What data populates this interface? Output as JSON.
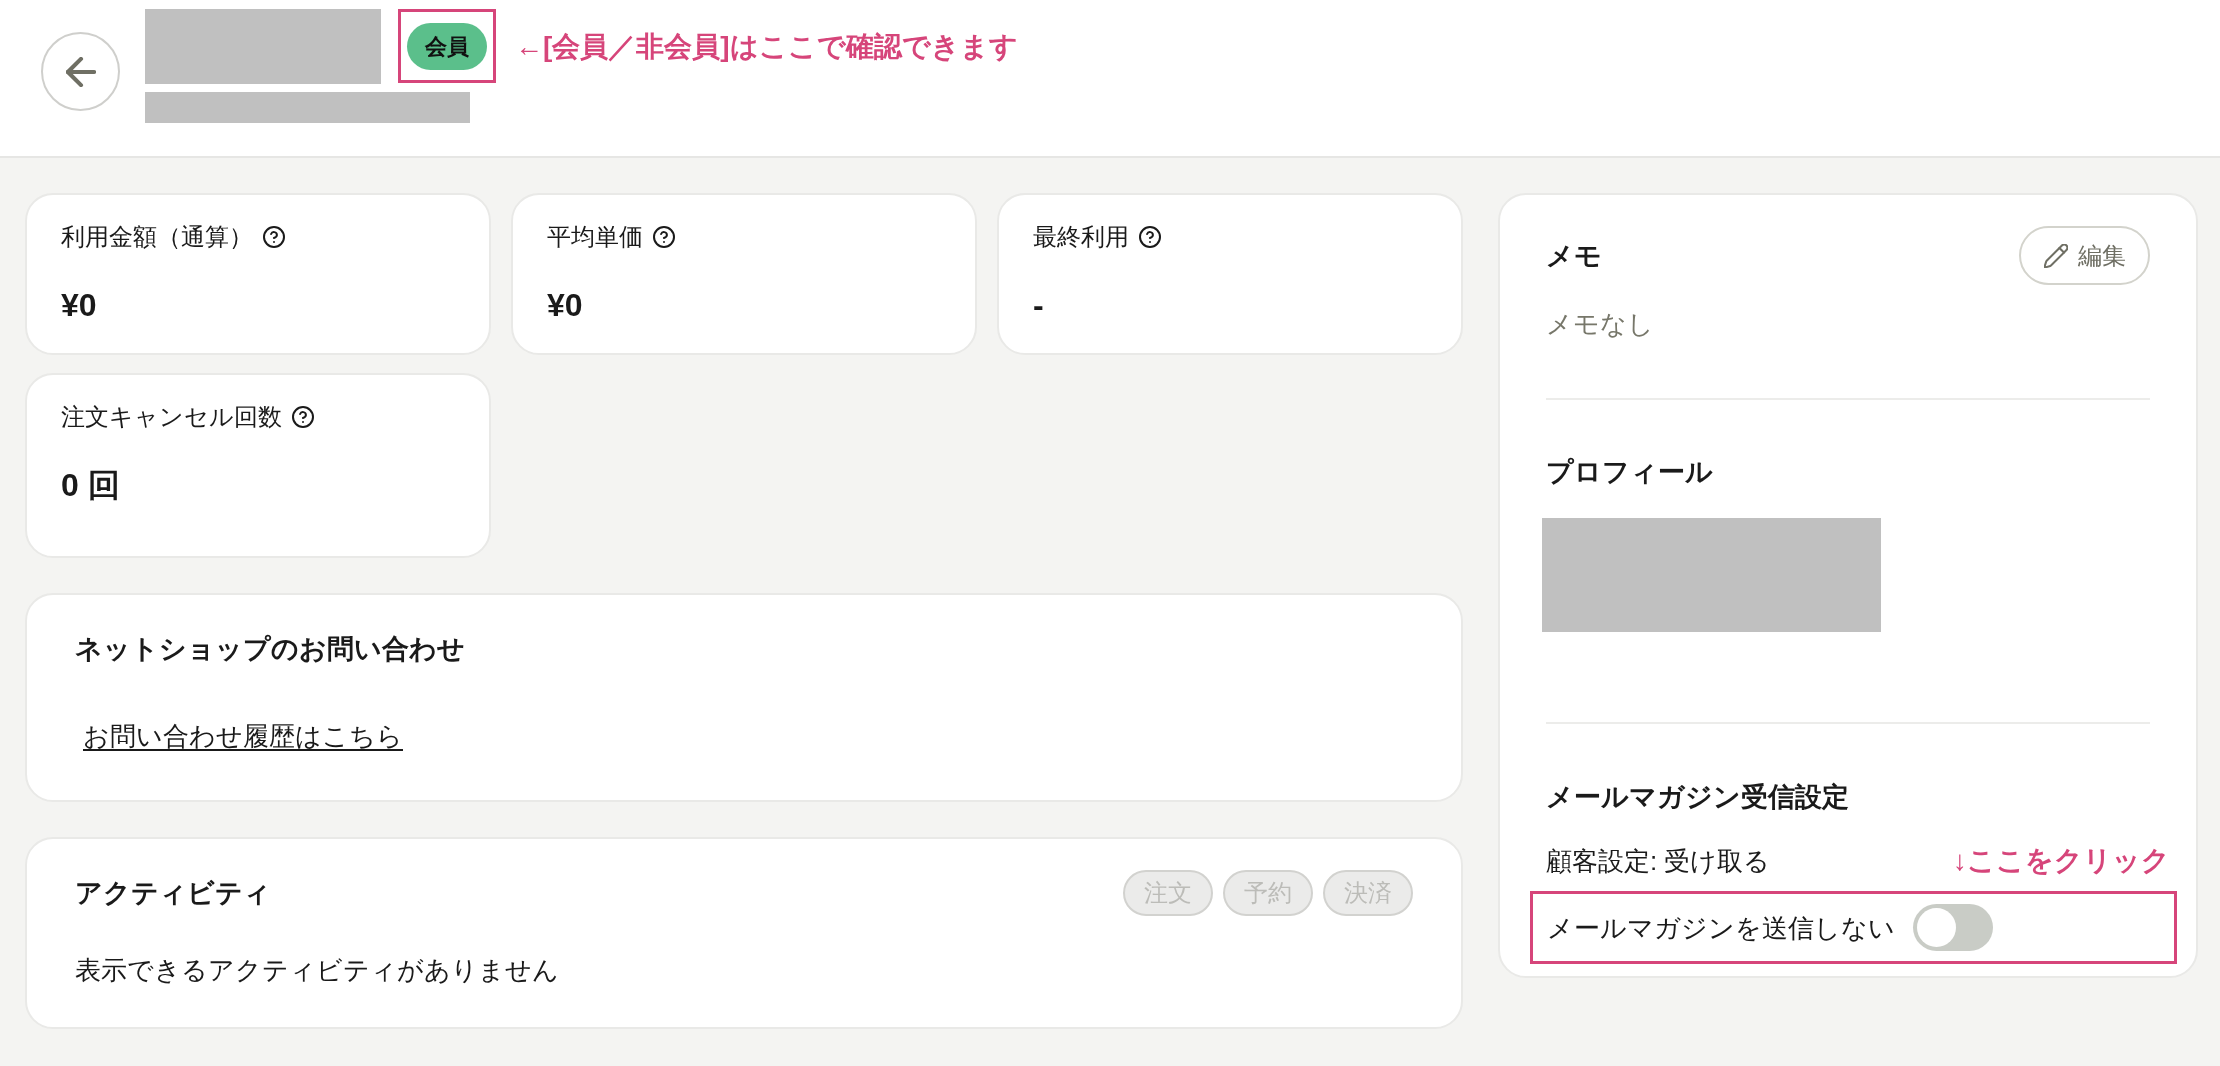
{
  "header": {
    "member_badge": {
      "label": "会員"
    },
    "annotation": "←[会員／非会員]はここで確認できます"
  },
  "stats": [
    {
      "label": "利用金額（通算）",
      "value": "¥0"
    },
    {
      "label": "平均単価",
      "value": "¥0"
    },
    {
      "label": "最終利用",
      "value": "-"
    },
    {
      "label": "注文キャンセル回数",
      "value": "0 回"
    }
  ],
  "inquiry_card": {
    "title": "ネットショップのお問い合わせ",
    "link": "お問い合わせ履歴はこちら"
  },
  "activity_card": {
    "title": "アクティビティ",
    "filters": [
      {
        "label": "注文",
        "disabled": true
      },
      {
        "label": "予約",
        "disabled": true
      },
      {
        "label": "決済",
        "disabled": true
      }
    ],
    "empty_message": "表示できるアクティビティがありません"
  },
  "side_panel": {
    "memo": {
      "title": "メモ",
      "edit_button": "編集",
      "content": "メモなし"
    },
    "profile": {
      "title": "プロフィール"
    },
    "newsletter": {
      "title": "メールマガジン受信設定",
      "customer_setting": "顧客設定: 受け取る",
      "annotation": "↓ここをクリック",
      "toggle": {
        "label": "メールマガジンを送信しない",
        "on": false
      }
    }
  }
}
